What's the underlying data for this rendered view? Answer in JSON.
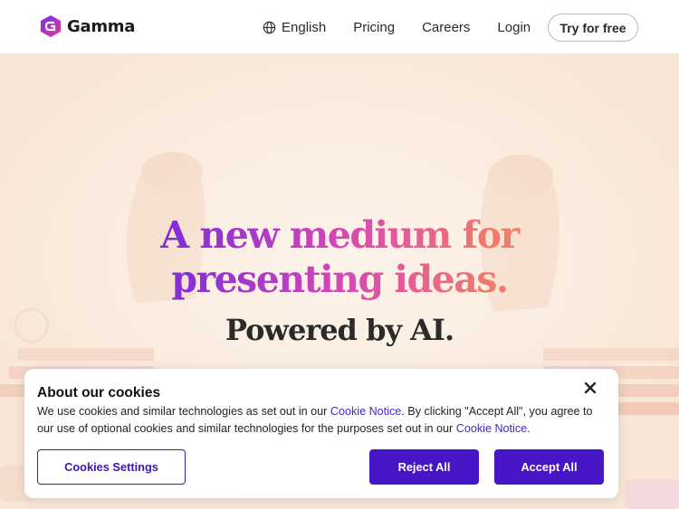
{
  "header": {
    "brand": "Gamma",
    "nav": {
      "language": "English",
      "pricing": "Pricing",
      "careers": "Careers",
      "login": "Login"
    },
    "cta": "Try for free"
  },
  "hero": {
    "title_line1": "A new medium for",
    "title_line2": "presenting ideas.",
    "subtitle": "Powered by AI."
  },
  "cookie_banner": {
    "title": "About our cookies",
    "text_part1": "We use cookies and similar technologies as set out in our ",
    "link1": "Cookie Notice",
    "text_part2": ". By clicking \"Accept All\", you agree to our use of optional cookies and similar technologies for the purposes set out in our ",
    "link2": "Cookie Notice",
    "text_part3": ".",
    "settings_button": "Cookies Settings",
    "reject_button": "Reject All",
    "accept_button": "Accept All"
  },
  "colors": {
    "accent": "#4716c7",
    "hero_gradient_start": "#5b1fd6",
    "hero_gradient_end": "#f4a25a",
    "background": "#fbeee3"
  }
}
